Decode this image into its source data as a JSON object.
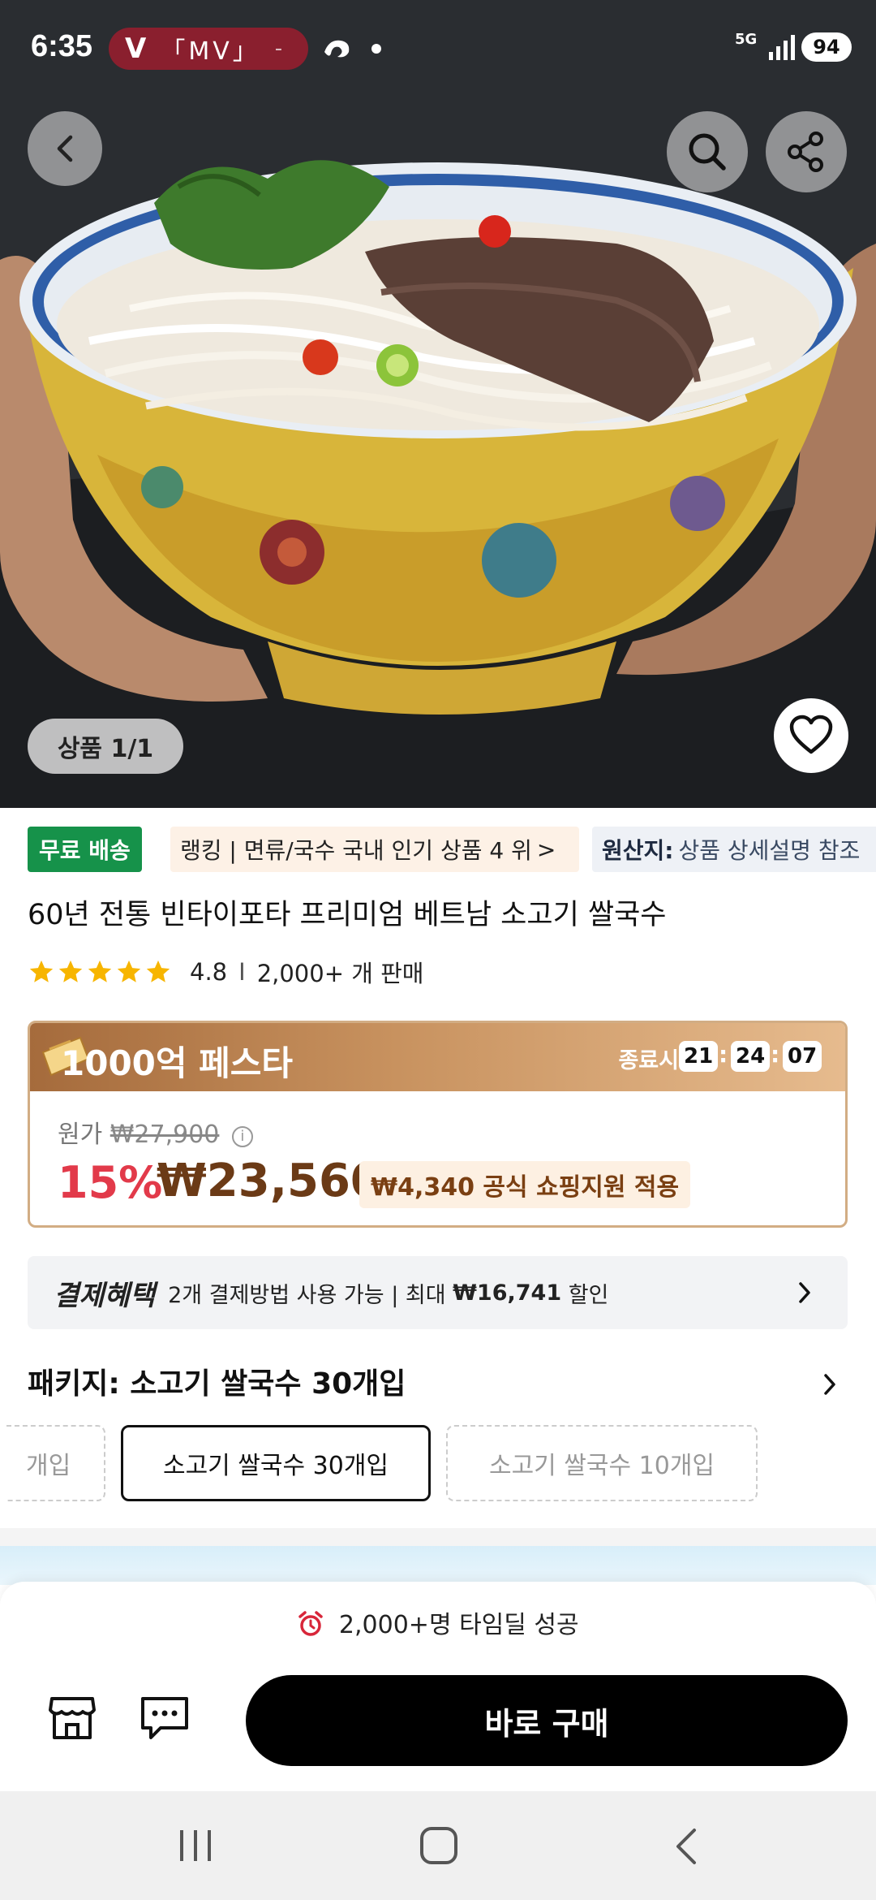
{
  "status_bar": {
    "time": "6:35",
    "app_pill_letter": "V",
    "app_pill_text": "「MV」",
    "app_pill_extra": "-",
    "network": "5G",
    "battery": "94"
  },
  "hero": {
    "image_counter": "상품 1/1"
  },
  "tags": {
    "free_shipping": "무료 배송",
    "ranking": "랭킹 | 면류/국수 국내 인기 상품 4 위",
    "ranking_arrow": ">",
    "origin_label": "원산지:",
    "origin_value": "상품 상세설명 참조"
  },
  "product": {
    "title": "60년 전통 빈타이포타 프리미엄 베트남 소고기 쌀국수",
    "rating": "4.8",
    "rating_separator": "I",
    "sold": "2,000+ 개 판매",
    "star_count": 5
  },
  "deal": {
    "title": "1000억 페스타",
    "end_label": "종료시간 :",
    "timer": [
      "21",
      "24",
      "07"
    ],
    "timer_sep": ":",
    "orig_label": "원가",
    "orig_price": "₩27,900",
    "info_glyph": "i",
    "discount": "15%",
    "price": "₩23,560",
    "support": "₩4,340 공식 쇼핑지원 적용"
  },
  "payment": {
    "label": "결제혜택",
    "text_pre": "2개 결제방법 사용 가능 | 최대 ",
    "text_amount": "₩16,741",
    "text_post": " 할인"
  },
  "package": {
    "title": "패키지: 소고기 쌀국수 30개입",
    "options": [
      {
        "label": "개입"
      },
      {
        "label": "소고기 쌀국수 30개입"
      },
      {
        "label": "소고기 쌀국수 10개입"
      }
    ]
  },
  "bottom": {
    "timedeal": "2,000+명 타임딜 성공",
    "buy_label": "바로 구매"
  },
  "colors": {
    "free_ship_green": "#16924a",
    "discount_red": "#e23a4a",
    "price_brown": "#6b3a16",
    "deal_header_start": "#a56b3c",
    "deal_header_end": "#e6bb8e",
    "mv_pill": "#8a1f2e",
    "star_yellow": "#f7b500"
  },
  "icons": {
    "back": "chevron-left-icon",
    "search": "search-icon",
    "share": "share-icon",
    "wishlist": "heart-icon",
    "star": "star-icon",
    "alarm": "alarm-clock-icon",
    "store": "store-icon",
    "chat": "chat-icon",
    "nav_recent": "recent-apps-icon",
    "nav_home": "home-icon",
    "nav_back": "back-icon"
  }
}
